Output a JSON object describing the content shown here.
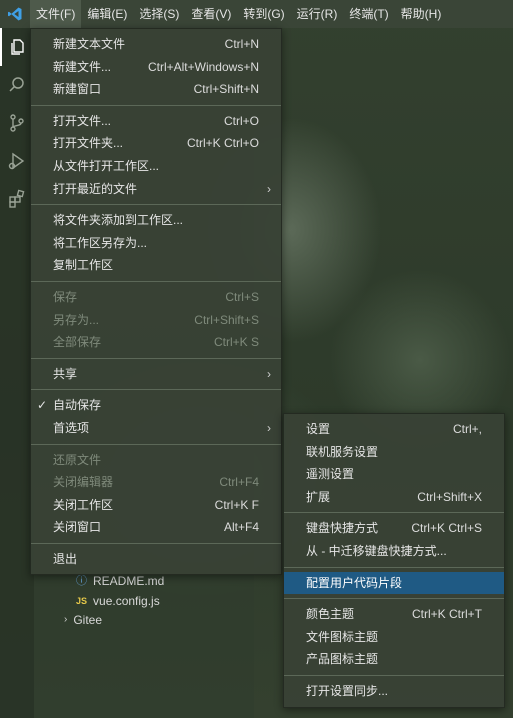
{
  "titlebar": {
    "menus": [
      "文件(F)",
      "编辑(E)",
      "选择(S)",
      "查看(V)",
      "转到(G)",
      "运行(R)",
      "终端(T)",
      "帮助(H)"
    ]
  },
  "activitybar": {
    "icons": [
      "explorer-icon",
      "search-icon",
      "source-control-icon",
      "run-debug-icon",
      "extensions-icon"
    ]
  },
  "explorer": {
    "items": [
      {
        "label": "README.md",
        "icon": "info-icon"
      },
      {
        "label": "vue.config.js",
        "icon": "js-icon"
      },
      {
        "label": "Gitee",
        "icon": "chevron-right-icon"
      }
    ]
  },
  "file_menu": {
    "groups": [
      [
        {
          "label": "新建文本文件",
          "key": "Ctrl+N"
        },
        {
          "label": "新建文件...",
          "key": "Ctrl+Alt+Windows+N"
        },
        {
          "label": "新建窗口",
          "key": "Ctrl+Shift+N"
        }
      ],
      [
        {
          "label": "打开文件...",
          "key": "Ctrl+O"
        },
        {
          "label": "打开文件夹...",
          "key": "Ctrl+K Ctrl+O"
        },
        {
          "label": "从文件打开工作区...",
          "key": ""
        },
        {
          "label": "打开最近的文件",
          "key": "",
          "submenu": true
        }
      ],
      [
        {
          "label": "将文件夹添加到工作区...",
          "key": ""
        },
        {
          "label": "将工作区另存为...",
          "key": ""
        },
        {
          "label": "复制工作区",
          "key": ""
        }
      ],
      [
        {
          "label": "保存",
          "key": "Ctrl+S",
          "disabled": true
        },
        {
          "label": "另存为...",
          "key": "Ctrl+Shift+S",
          "disabled": true
        },
        {
          "label": "全部保存",
          "key": "Ctrl+K S",
          "disabled": true
        }
      ],
      [
        {
          "label": "共享",
          "key": "",
          "submenu": true
        }
      ],
      [
        {
          "label": "自动保存",
          "key": "",
          "checked": true
        },
        {
          "label": "首选项",
          "key": "",
          "submenu": true,
          "open": true
        }
      ],
      [
        {
          "label": "还原文件",
          "key": "",
          "disabled": true
        },
        {
          "label": "关闭编辑器",
          "key": "Ctrl+F4",
          "disabled": true
        },
        {
          "label": "关闭工作区",
          "key": "Ctrl+K F"
        },
        {
          "label": "关闭窗口",
          "key": "Alt+F4"
        }
      ],
      [
        {
          "label": "退出",
          "key": ""
        }
      ]
    ]
  },
  "preferences_menu": {
    "groups": [
      [
        {
          "label": "设置",
          "key": "Ctrl+,"
        },
        {
          "label": "联机服务设置",
          "key": ""
        },
        {
          "label": "遥测设置",
          "key": ""
        },
        {
          "label": "扩展",
          "key": "Ctrl+Shift+X"
        }
      ],
      [
        {
          "label": "键盘快捷方式",
          "key": "Ctrl+K Ctrl+S"
        },
        {
          "label": "从 - 中迁移键盘快捷方式...",
          "key": ""
        }
      ],
      [
        {
          "label": "配置用户代码片段",
          "key": "",
          "highlight": true
        }
      ],
      [
        {
          "label": "颜色主题",
          "key": "Ctrl+K Ctrl+T"
        },
        {
          "label": "文件图标主题",
          "key": ""
        },
        {
          "label": "产品图标主题",
          "key": ""
        }
      ],
      [
        {
          "label": "打开设置同步...",
          "key": ""
        }
      ]
    ]
  }
}
